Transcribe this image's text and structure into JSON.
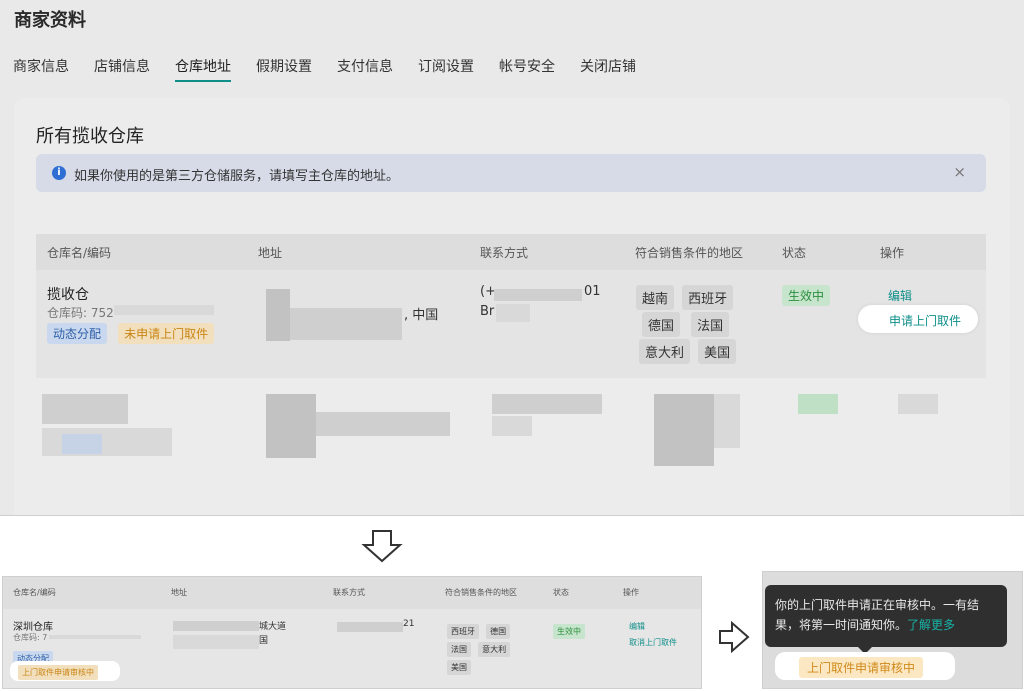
{
  "page": {
    "title": "商家资料",
    "tabs": [
      {
        "label": "商家信息"
      },
      {
        "label": "店铺信息"
      },
      {
        "label": "仓库地址"
      },
      {
        "label": "假期设置"
      },
      {
        "label": "支付信息"
      },
      {
        "label": "订阅设置"
      },
      {
        "label": "帐号安全"
      },
      {
        "label": "关闭店铺"
      }
    ],
    "active_tab": "仓库地址"
  },
  "card": {
    "title": "所有揽收仓库",
    "notice": "如果你使用的是第三方仓储服务，请填写主仓库的地址。",
    "notice_close": "×"
  },
  "table": {
    "columns": [
      "仓库名/编码",
      "地址",
      "联系方式",
      "符合销售条件的地区",
      "状态",
      "操作"
    ],
    "row": {
      "name": "揽收仓",
      "code": "仓库码: 752",
      "tag_dynamic": "动态分配",
      "tag_pickup": "未申请上门取件",
      "address_suffix": ", 中国",
      "contact_prefix": "(+",
      "contact_suffix": "01",
      "contact_line2": "Br",
      "regions": [
        "越南",
        "西班牙",
        "德国",
        "法国",
        "意大利",
        "美国"
      ],
      "status": "生效中",
      "action_edit": "编辑",
      "action_pickup": "申请上门取件"
    }
  },
  "bottom_left": {
    "columns": [
      "仓库名/编码",
      "地址",
      "联系方式",
      "符合销售条件的地区",
      "状态",
      "操作"
    ],
    "row": {
      "name": "深圳仓库",
      "code": "仓库码: 7",
      "tag_dynamic": "动态分配",
      "tag_pickup_review": "上门取件申请审核中",
      "address_part1": "城大道",
      "address_part2": "国",
      "contact_suffix": "21",
      "regions": [
        "西班牙",
        "德国",
        "法国",
        "意大利",
        "美国"
      ],
      "status": "生效中",
      "action_edit": "编辑",
      "action_cancel": "取消上门取件"
    }
  },
  "bottom_right": {
    "tooltip_text": "你的上门取件申请正在审核中。一有结果，将第一时间通知你。",
    "tooltip_link": "了解更多",
    "badge": "上门取件申请审核中"
  },
  "icons": {
    "info": "info-icon",
    "close": "close-icon",
    "down_arrow": "down-arrow-icon",
    "right_arrow": "right-arrow-icon"
  },
  "colors": {
    "accent": "#0f8f8a",
    "info_blue": "#2f6fd4",
    "warning_orange": "#c98615",
    "success_green": "#2b8f3e"
  }
}
